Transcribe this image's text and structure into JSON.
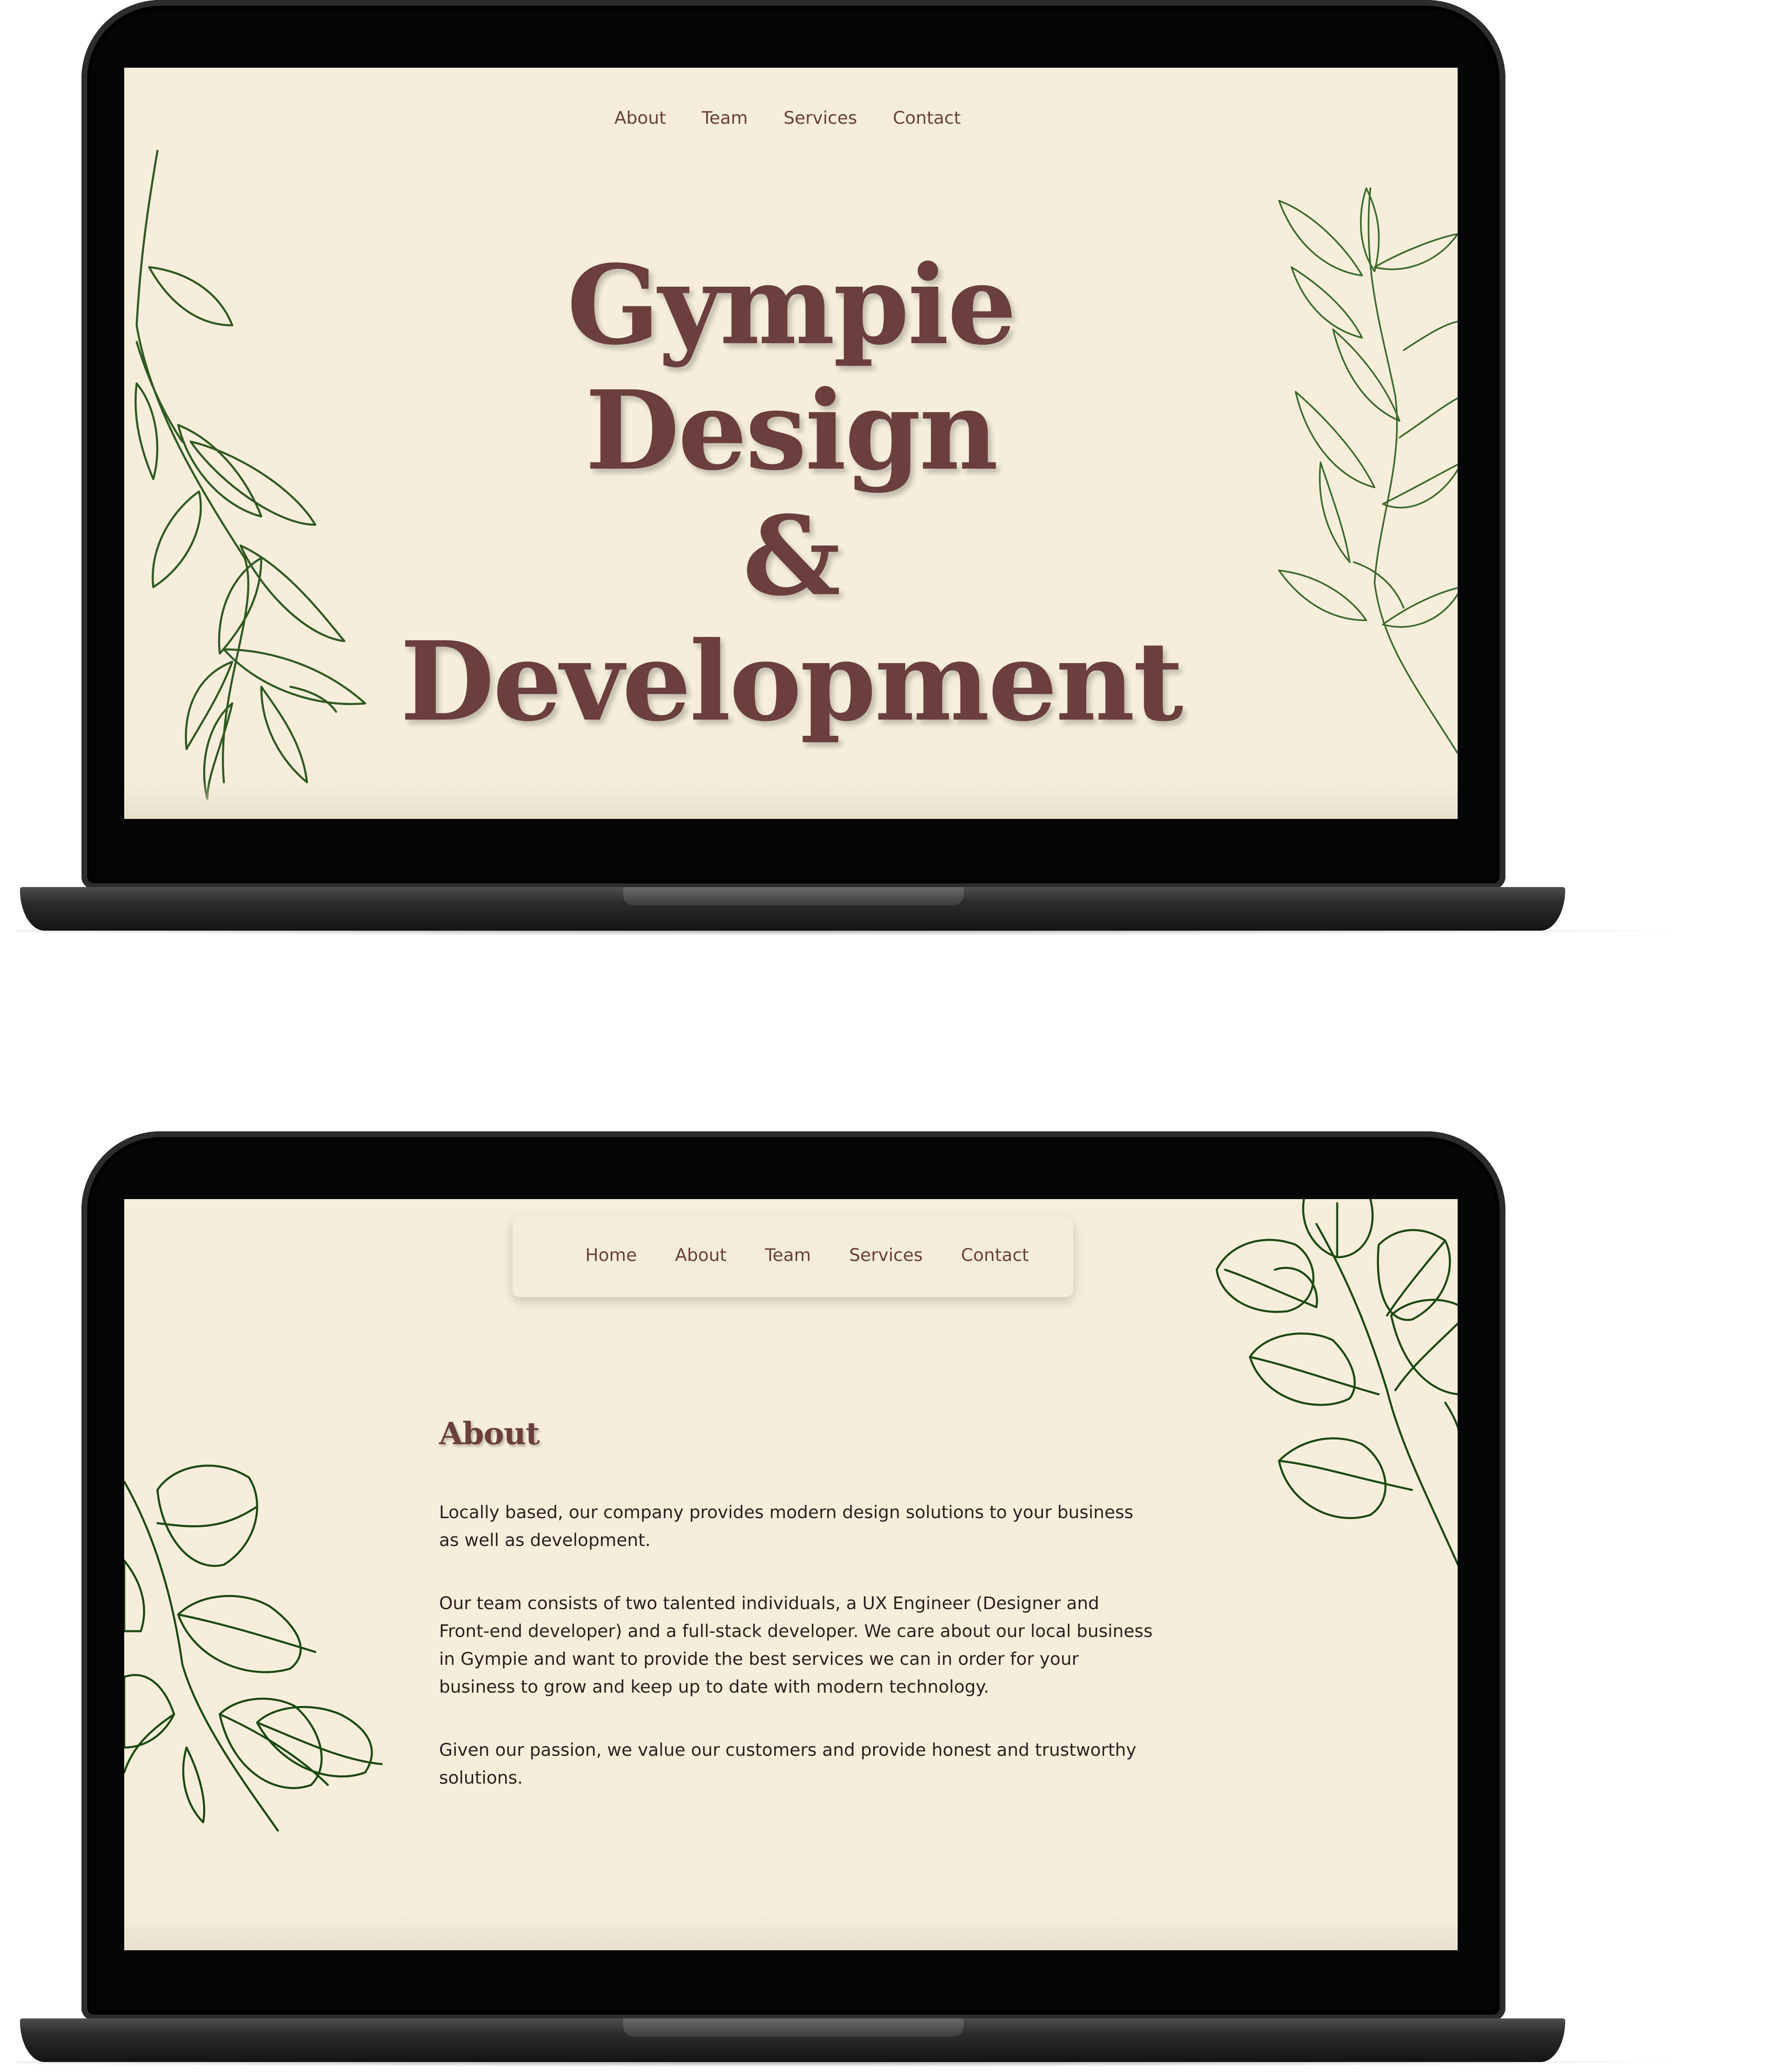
{
  "home_page": {
    "nav": {
      "items": [
        {
          "label": "About"
        },
        {
          "label": "Team"
        },
        {
          "label": "Services"
        },
        {
          "label": "Contact"
        }
      ]
    },
    "hero": {
      "lines": [
        "Gympie",
        "Design",
        "&",
        "Development"
      ]
    }
  },
  "about_page": {
    "nav": {
      "items": [
        {
          "label": "Home"
        },
        {
          "label": "About"
        },
        {
          "label": "Team"
        },
        {
          "label": "Services"
        },
        {
          "label": "Contact"
        }
      ]
    },
    "heading": "About",
    "paragraphs": [
      "Locally based, our company provides modern design solutions to your business as well as development.",
      "Our team consists of two talented individuals, a UX Engineer (Designer and Front-end developer) and a full-stack developer. We care about our local business in Gympie and want to provide the best services we can in order for your business to grow and keep up to date with modern technology.",
      "Given our passion, we value our customers and provide honest and trustworthy solutions."
    ]
  },
  "theme": {
    "background": "#f6eedb",
    "accent_text": "#6b3f3d",
    "leaf_green": "#1c4a12",
    "device_black": "#050505"
  }
}
